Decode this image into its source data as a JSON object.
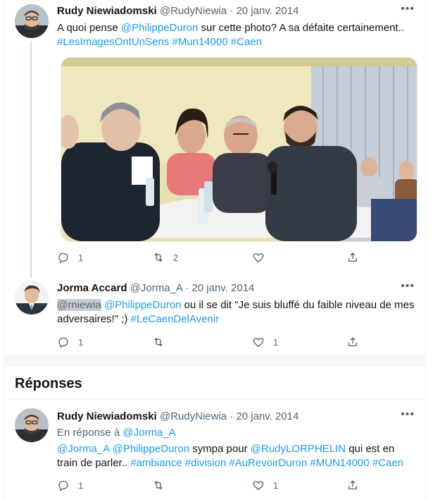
{
  "tweet1": {
    "name": "Rudy Niewiadomski",
    "handle_date": "@RudyNiewia · 20 janv. 2014",
    "text_pre": "A quoi pense ",
    "mention": "@PhilippeDuron",
    "text_post": " sur cette photo? A sa défaite certainement..",
    "hashtags": [
      "#LesImagesOntUnSens",
      "#Mun14000",
      "#Caen"
    ],
    "actions": {
      "reply": "1",
      "retweet": "2",
      "like": ""
    }
  },
  "tweet2": {
    "name": "Jorma Accard",
    "handle_date": "@Jorma_A · 20 janv. 2014",
    "mention_grey": "@rniewia",
    "mention": "@PhilippeDuron",
    "text": " ou il se dit \"Je suis bluffé du faible niveau de mes adversaires!\" ;) ",
    "hashtag": "#LeCaenDelAvenir",
    "actions": {
      "reply": "1",
      "retweet": "",
      "like": "1"
    }
  },
  "replies_title": "Réponses",
  "tweet3": {
    "name": "Rudy Niewiadomski",
    "handle_date": "@RudyNiewia · 20 janv. 2014",
    "reply_prefix": "En réponse à ",
    "reply_to": "@Jorma_A",
    "mention1": "@Jorma_A",
    "mention2": "@PhilippeDuron",
    "text1": " sympa pour ",
    "mention3": "@RudyLORPHELIN",
    "text2": " qui est en train de parler.. ",
    "hashtags": [
      "#ambiance",
      "#division",
      "#AuRevoirDuron",
      "#MUN14000",
      "#Caen"
    ],
    "actions": {
      "reply": "1",
      "retweet": "",
      "like": "1"
    }
  },
  "more_glyph": "•••",
  "colors": {
    "link": "#1d9bf0",
    "text": "#0f1419",
    "meta": "#536471",
    "divider": "#eff3f4"
  }
}
